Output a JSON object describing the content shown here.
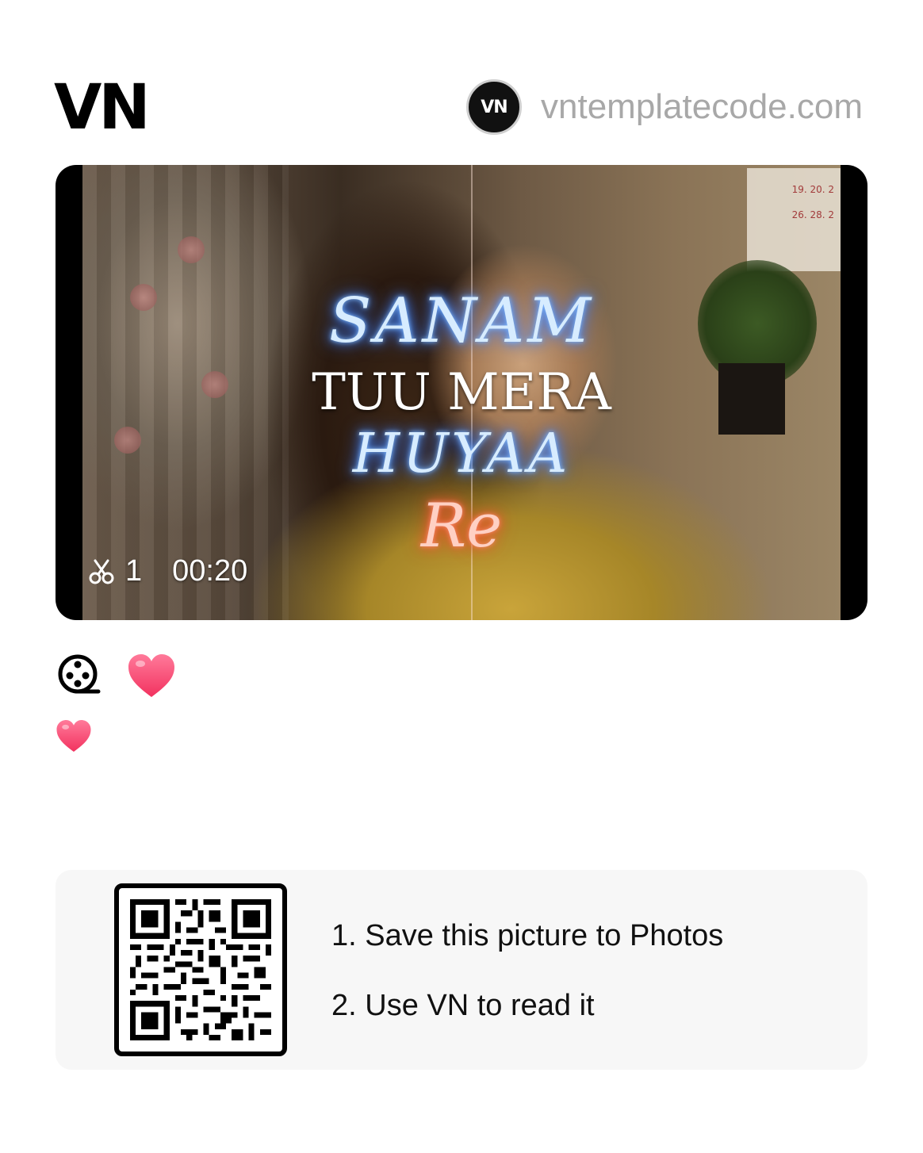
{
  "brand": {
    "logo_text": "VN"
  },
  "creator": {
    "avatar_text": "VN",
    "name": "vntemplatecode.com"
  },
  "video": {
    "overlay_lines": [
      "SANAM",
      "TUU MERA",
      "HUYAA",
      "Re"
    ],
    "clip_count": "1",
    "duration": "00:20",
    "calendar_rows": [
      "19. 20. 2",
      "26. 28. 2"
    ]
  },
  "tags": {
    "icons": [
      "film-reel-icon",
      "heart-icon",
      "heart-icon"
    ]
  },
  "qr": {
    "steps": [
      "1. Save this picture to Photos",
      "2. Use VN to read it"
    ]
  },
  "colors": {
    "heart": "#ff4d79",
    "creator_text": "#a8a8a8",
    "panel_bg": "#f7f7f7"
  }
}
